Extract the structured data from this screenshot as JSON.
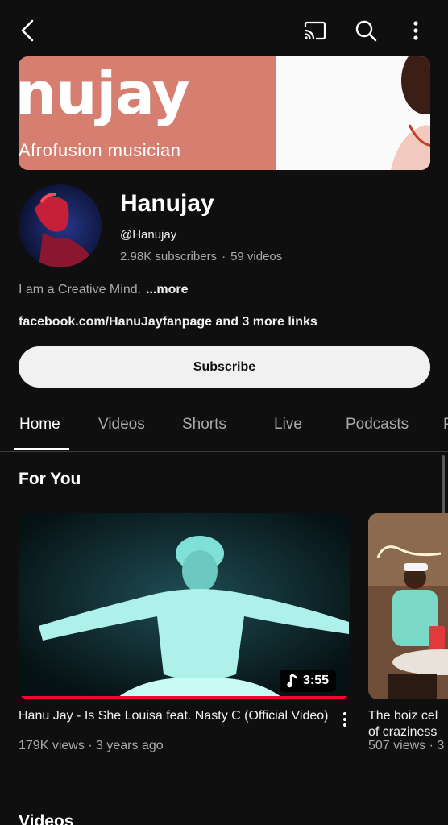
{
  "topbar": {
    "back_icon": "chevron-left-icon",
    "cast_icon": "cast-icon",
    "search_icon": "search-icon",
    "more_icon": "more-vert-icon"
  },
  "banner": {
    "name_text": "nujay",
    "tagline": "Afrofusion musician",
    "colors": {
      "left": "#d67f71",
      "right": "#fafafa"
    }
  },
  "channel": {
    "name": "Hanujay",
    "handle": "@Hanujay",
    "subscribers": "2.98K subscribers",
    "separator": "·",
    "videos": "59 videos",
    "description": "I am a Creative Mind.",
    "more_label": "...more",
    "links": "facebook.com/HanuJayfanpage and 3 more links",
    "subscribe_label": "Subscribe"
  },
  "tabs": [
    {
      "label": "Home",
      "active": true
    },
    {
      "label": "Videos",
      "active": false
    },
    {
      "label": "Shorts",
      "active": false
    },
    {
      "label": "Live",
      "active": false
    },
    {
      "label": "Podcasts",
      "active": false
    },
    {
      "label": "P",
      "active": false
    }
  ],
  "for_you": {
    "title": "For You",
    "videos": [
      {
        "title": "Hanu Jay - Is She Louisa feat. Nasty C (Official Video)",
        "meta": "179K views · 3 years ago",
        "duration": "3:55",
        "duration_icon": "music-note-icon",
        "progress": 1.0
      },
      {
        "title": "The boiz cel",
        "title_line2": "of craziness",
        "meta": "507 views · 3"
      }
    ]
  },
  "next_section": {
    "title": "Videos"
  },
  "colors": {
    "background": "#0f0f0f",
    "accent": "#ff0033",
    "text": "#f1f1f1",
    "muted": "#aaaaaa"
  }
}
